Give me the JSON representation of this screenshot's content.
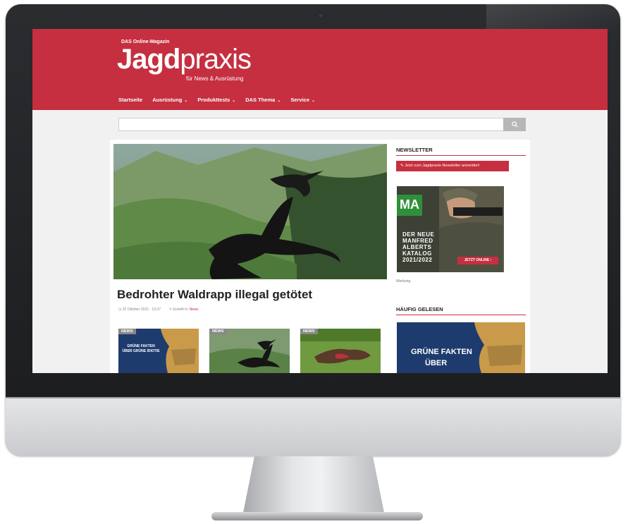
{
  "site": {
    "tagline_top": "DAS Online-Magazin",
    "logo_bold": "Jagd",
    "logo_light": "praxis",
    "logo_sub": "für News & Ausrüstung",
    "brand_color": "#c62f3f"
  },
  "nav": {
    "items": [
      {
        "label": "Startseite",
        "has_menu": false
      },
      {
        "label": "Ausrüstung",
        "has_menu": true
      },
      {
        "label": "Produkttests",
        "has_menu": true
      },
      {
        "label": "DAS Thema",
        "has_menu": true
      },
      {
        "label": "Service",
        "has_menu": true
      }
    ],
    "chevron": "⌄"
  },
  "search": {
    "placeholder": "",
    "button_icon": "search-icon",
    "button_glyph": "🔍"
  },
  "main": {
    "headline": "Bedrohter Waldrapp illegal getötet",
    "date": "22 Oktober 2021 - 13:37",
    "category_prefix": "Erstellt in:",
    "category": "News",
    "cards": [
      {
        "badge": "NEWS",
        "text": "GRÜNE FAKTEN ÜBER GRÜNE IDIOTIE"
      },
      {
        "badge": "NEWS"
      },
      {
        "badge": "NEWS"
      }
    ]
  },
  "sidebar": {
    "newsletter_title": "NEWSLETTER",
    "newsletter_button": "Jetzt zum Jagdpraxis Newsletter anmelden!",
    "ad": {
      "logo": "MA",
      "text_lines": [
        "DER NEUE",
        "MANFRED",
        "ALBERTS",
        "KATALOG",
        "2021/2022"
      ],
      "cta": "JETZT ONLINE"
    },
    "ad_label": "Werbung",
    "popular_title": "HÄUFIG GELESEN",
    "popular_text_1": "GRÜNE FAKTEN",
    "popular_text_2": "ÜBER"
  }
}
